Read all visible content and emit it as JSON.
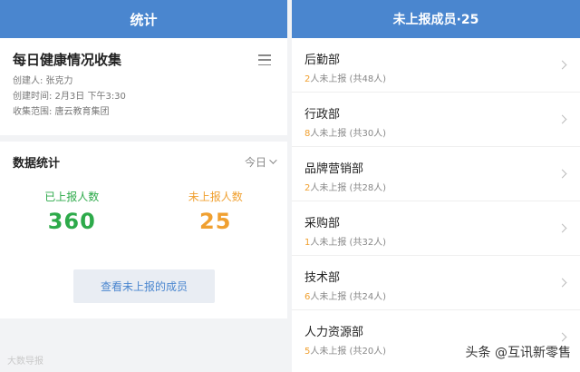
{
  "left": {
    "header_title": "统计",
    "form": {
      "title": "每日健康情况收集",
      "creator": "创建人: 张克力",
      "created_time": "创建时间: 2月3日 下午3:30",
      "scope": "收集范围: 唐云教育集团"
    },
    "stats": {
      "title": "数据统计",
      "period": "今日",
      "reported_label": "已上报人数",
      "reported_value": "360",
      "unreported_label": "未上报人数",
      "unreported_value": "25",
      "view_button": "查看未上报的成员"
    },
    "watermark": "大数导报"
  },
  "right": {
    "header_title": "未上报成员·25",
    "departments": [
      {
        "name": "后勤部",
        "count": "2",
        "suffix": "人未上报  (共48人)"
      },
      {
        "name": "行政部",
        "count": "8",
        "suffix": "人未上报  (共30人)"
      },
      {
        "name": "品牌营销部",
        "count": "2",
        "suffix": "人未上报  (共28人)"
      },
      {
        "name": "采购部",
        "count": "1",
        "suffix": "人未上报  (共32人)"
      },
      {
        "name": "技术部",
        "count": "6",
        "suffix": "人未上报  (共24人)"
      },
      {
        "name": "人力资源部",
        "count": "5",
        "suffix": "人未上报  (共20人)"
      }
    ],
    "watermark": "头条 @互讯新零售"
  },
  "colors": {
    "header_blue": "#4a86cf",
    "reported_green": "#2daa4a",
    "unreported_orange": "#f0a030"
  }
}
